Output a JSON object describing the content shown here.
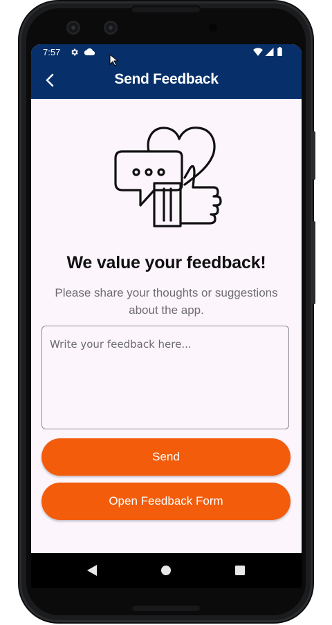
{
  "status_bar": {
    "time": "7:57",
    "icons": [
      "settings-icon",
      "cloud-icon",
      "wifi-icon",
      "signal-icon",
      "battery-icon"
    ]
  },
  "app_bar": {
    "title": "Send Feedback",
    "back_icon": "chevron-left-icon"
  },
  "content": {
    "illustration_icon": "feedback-heart-thumbs-up-icon",
    "heading": "We value your feedback!",
    "subtext": "Please share your thoughts or suggestions about the app.",
    "feedback_input": {
      "placeholder": "Write your feedback here...",
      "value": ""
    },
    "send_button": "Send",
    "open_form_button": "Open Feedback Form"
  },
  "nav_bar": {
    "items": [
      "back-triangle-icon",
      "home-circle-icon",
      "recents-square-icon"
    ]
  },
  "colors": {
    "app_bar": "#07306a",
    "accent": "#f25c0a",
    "background": "#fdf5fc"
  }
}
